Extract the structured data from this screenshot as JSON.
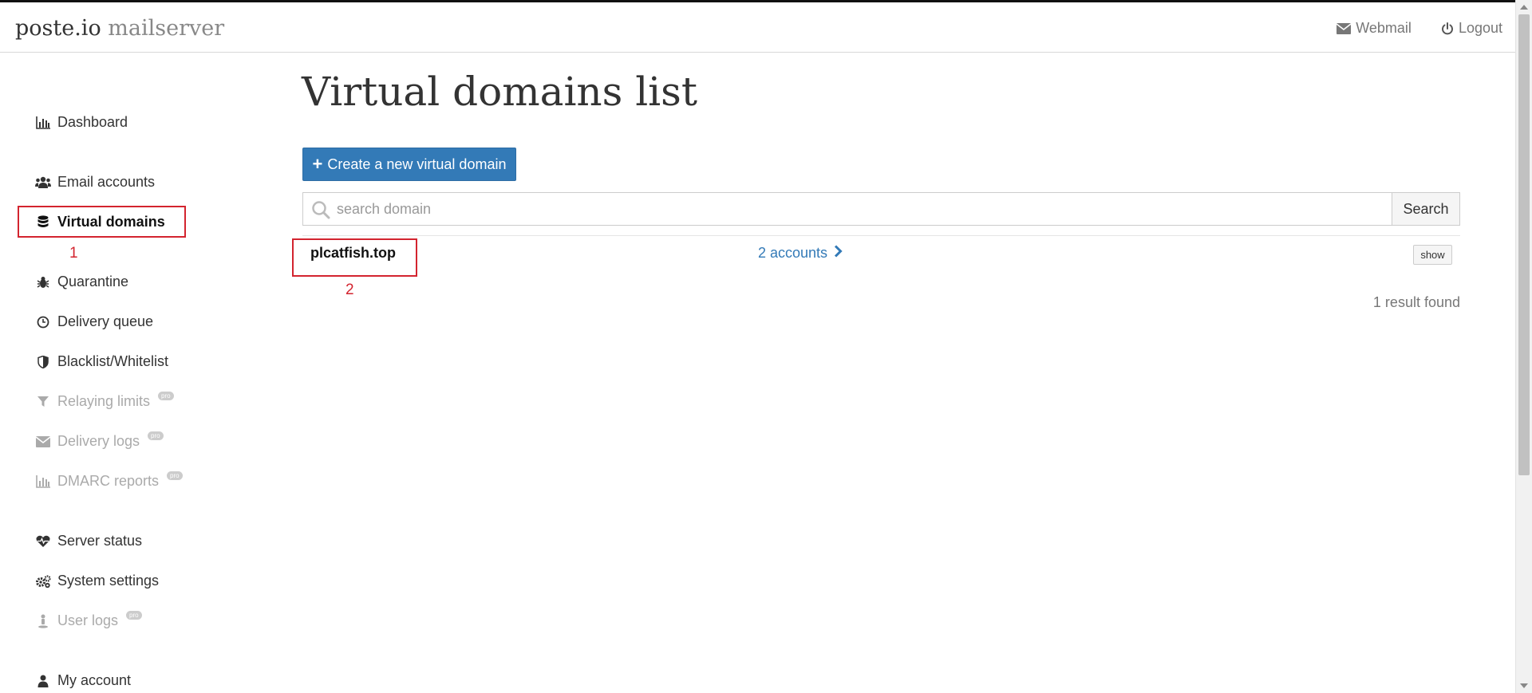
{
  "header": {
    "brand_primary": "poste.io",
    "brand_secondary": "mailserver",
    "webmail_label": "Webmail",
    "logout_label": "Logout"
  },
  "sidebar": {
    "items": [
      {
        "label": "Dashboard",
        "icon": "bar-chart-icon",
        "state": "normal"
      },
      {
        "label": "Email accounts",
        "icon": "users-icon",
        "state": "normal"
      },
      {
        "label": "Virtual domains",
        "icon": "database-icon",
        "state": "active"
      },
      {
        "label": "Quarantine",
        "icon": "bug-icon",
        "state": "normal"
      },
      {
        "label": "Delivery queue",
        "icon": "clock-icon",
        "state": "normal"
      },
      {
        "label": "Blacklist/Whitelist",
        "icon": "shield-icon",
        "state": "normal"
      },
      {
        "label": "Relaying limits",
        "icon": "filter-icon",
        "state": "disabled",
        "badge": "pro"
      },
      {
        "label": "Delivery logs",
        "icon": "envelope-icon",
        "state": "disabled",
        "badge": "pro"
      },
      {
        "label": "DMARC reports",
        "icon": "bar-chart-icon",
        "state": "disabled",
        "badge": "pro"
      },
      {
        "label": "Server status",
        "icon": "heartbeat-icon",
        "state": "normal"
      },
      {
        "label": "System settings",
        "icon": "gears-icon",
        "state": "normal"
      },
      {
        "label": "User logs",
        "icon": "user-location-icon",
        "state": "disabled",
        "badge": "pro"
      },
      {
        "label": "My account",
        "icon": "user-icon",
        "state": "normal"
      }
    ]
  },
  "main": {
    "title": "Virtual domains list",
    "create_button_label": "Create a new virtual domain",
    "search": {
      "placeholder": "search domain",
      "value": "",
      "button_label": "Search"
    },
    "rows": [
      {
        "domain": "plcatfish.top",
        "accounts_label": "2 accounts",
        "show_label": "show"
      }
    ],
    "result_count": "1 result found"
  },
  "annotations": [
    {
      "number": "1"
    },
    {
      "number": "2"
    }
  ],
  "colors": {
    "accent": "#337ab7",
    "annotation": "#d3242f",
    "disabled_text": "#aaaaaa"
  }
}
